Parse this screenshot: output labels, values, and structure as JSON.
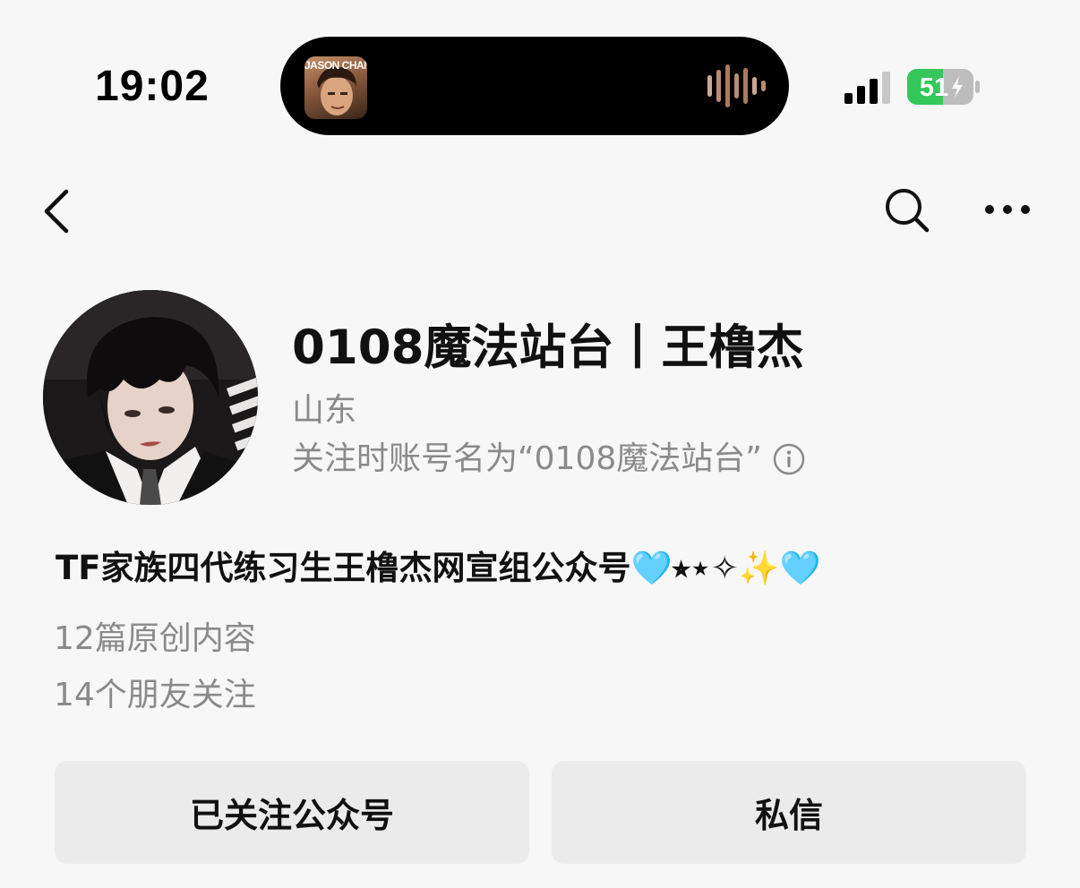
{
  "status_bar": {
    "time": "19:02",
    "battery_level": "51",
    "now_playing_label": "JASON CHAN",
    "signal_bars": 3
  },
  "nav": {
    "back_icon": "chevron-left-icon",
    "search_icon": "search-icon",
    "more_icon": "more-horizontal-icon"
  },
  "profile": {
    "name": "0108魔法站台丨王橹杰",
    "region": "山东",
    "former_name": "关注时账号名为“0108魔法站台”",
    "description": "TF家族四代练习生王橹杰网宣组公众号🩵⭒⋆✧✨🩵",
    "original_articles": "12篇原创内容",
    "friends_following": "14个朋友关注"
  },
  "actions": {
    "follow_label": "已关注公众号",
    "message_label": "私信"
  },
  "colors": {
    "background": "#f7f7f7",
    "button_bg": "#ebebeb",
    "secondary_text": "#8a8a8a",
    "battery_green": "#34c759"
  }
}
